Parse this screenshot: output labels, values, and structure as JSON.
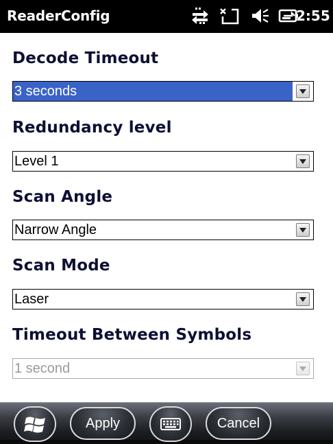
{
  "titlebar": {
    "app_title": "ReaderConfig",
    "time": "2:55",
    "status_icons": [
      "data-connection-icon",
      "no-signal-icon",
      "volume-muted-icon",
      "battery-charging-icon"
    ]
  },
  "fields": [
    {
      "label": "Decode Timeout",
      "value": "3 seconds",
      "state": "selected"
    },
    {
      "label": "Redundancy level",
      "value": "Level 1",
      "state": "normal"
    },
    {
      "label": "Scan Angle",
      "value": "Narrow Angle",
      "state": "normal"
    },
    {
      "label": "Scan Mode",
      "value": "Laser",
      "state": "normal"
    },
    {
      "label": "Timeout Between Symbols",
      "value": "1 second",
      "state": "disabled"
    }
  ],
  "softkeys": {
    "start_icon": "windows-start-icon",
    "apply_label": "Apply",
    "keyboard_icon": "keyboard-icon",
    "cancel_label": "Cancel"
  },
  "colors": {
    "label_text": "#0d0f33",
    "selection": "#3a63c8",
    "titlebar": "#000000"
  }
}
